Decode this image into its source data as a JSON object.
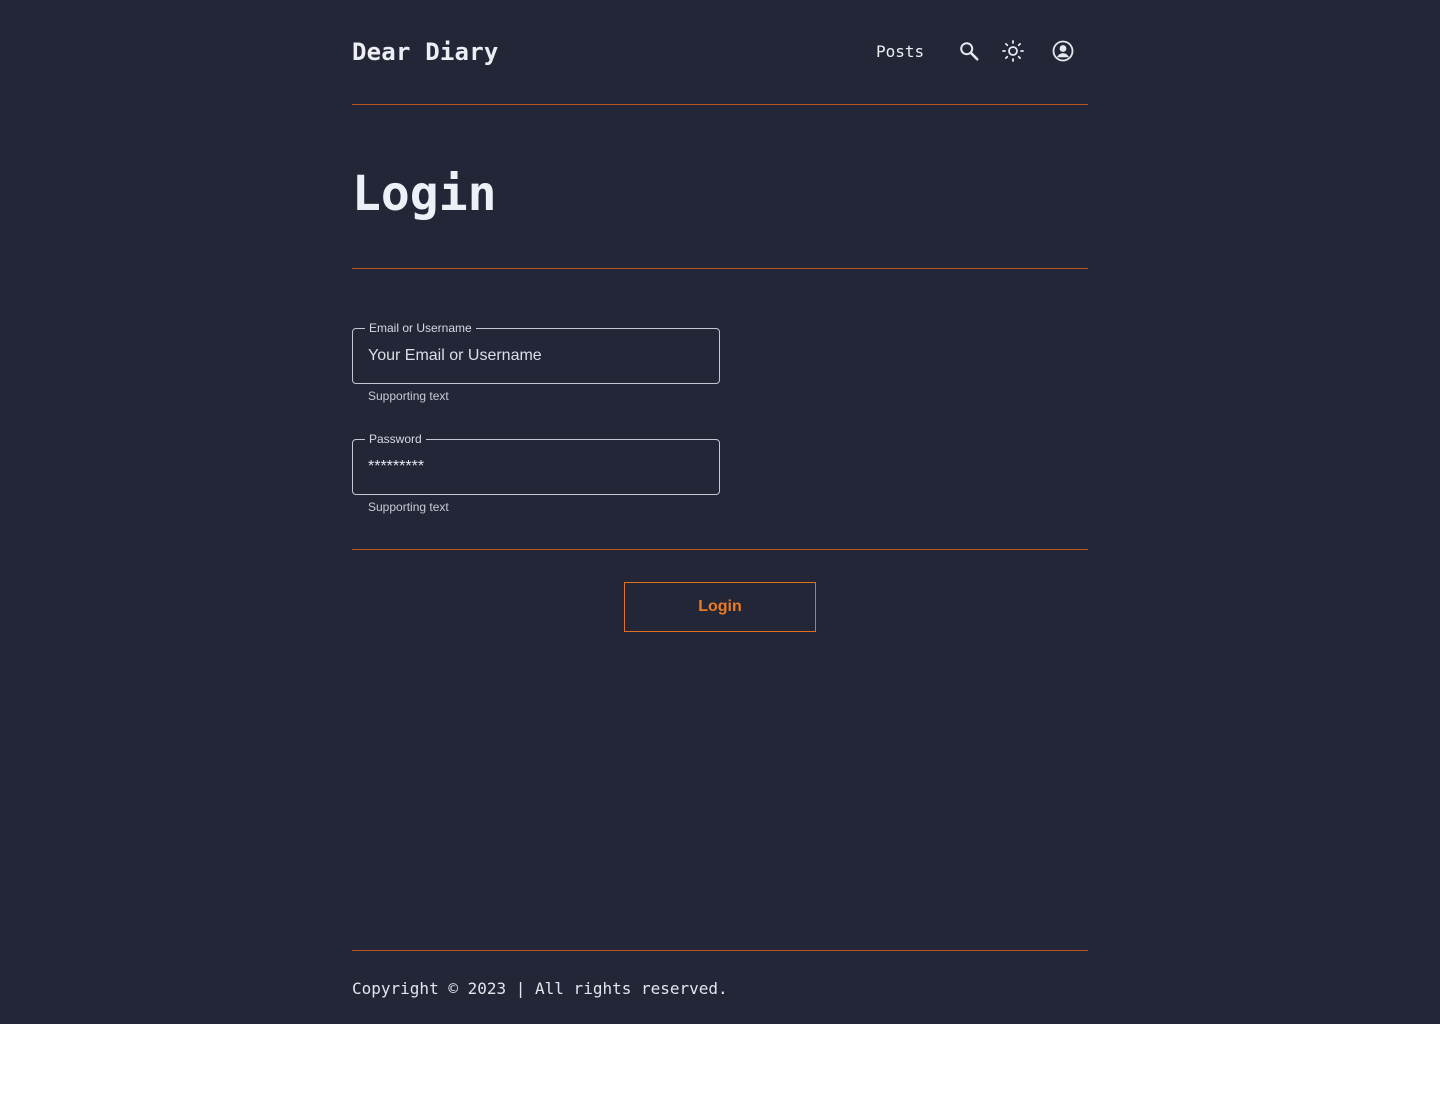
{
  "header": {
    "brand": "Dear Diary",
    "nav": {
      "posts_label": "Posts"
    },
    "icons": {
      "search": "search-icon",
      "theme": "sun-icon",
      "account": "account-circle-icon"
    }
  },
  "main": {
    "title": "Login",
    "form": {
      "email": {
        "label": "Email or Username",
        "placeholder": "Your Email or Username",
        "value": "",
        "supporting_text": "Supporting text"
      },
      "password": {
        "label": "Password",
        "value": "*********",
        "supporting_text": "Supporting text"
      },
      "submit_label": "Login"
    }
  },
  "footer": {
    "copyright": "Copyright © 2023 | All rights reserved."
  },
  "colors": {
    "background": "#222637",
    "accent": "#e2711d",
    "divider": "#b9541c",
    "text": "#e9eaf0"
  }
}
